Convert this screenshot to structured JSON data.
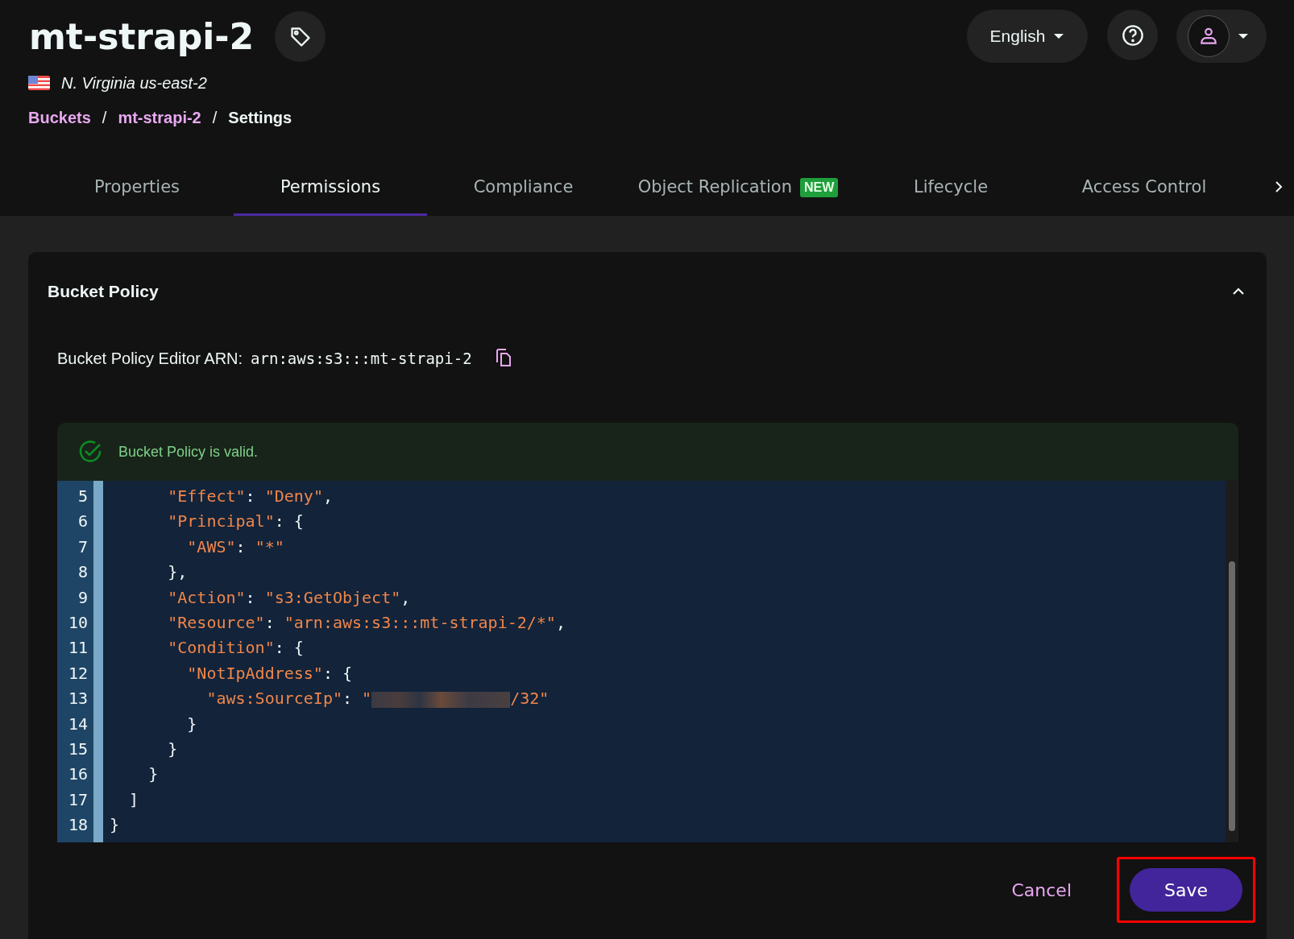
{
  "header": {
    "title": "mt-strapi-2",
    "region": "N. Virginia us-east-2",
    "breadcrumb_separator": "/",
    "breadcrumbs": [
      {
        "label": "Buckets",
        "link": true
      },
      {
        "label": "mt-strapi-2",
        "link": true
      },
      {
        "label": "Settings",
        "link": false
      }
    ],
    "language": "English"
  },
  "tabs": [
    {
      "label": "Properties",
      "selected": false
    },
    {
      "label": "Permissions",
      "selected": true
    },
    {
      "label": "Compliance",
      "selected": false
    },
    {
      "label": "Object Replication",
      "badge": "NEW",
      "selected": false
    },
    {
      "label": "Lifecycle",
      "selected": false
    },
    {
      "label": "Access Control",
      "selected": false
    }
  ],
  "panel": {
    "title": "Bucket Policy",
    "expanded": true,
    "arn_label": "Bucket Policy Editor ARN:",
    "arn": "arn:aws:s3:::mt-strapi-2",
    "validation": "Bucket Policy is valid.",
    "code_lines": [
      {
        "number": "5",
        "tokens": [
          {
            "kind": "key",
            "text": "      \"Effect\""
          },
          {
            "kind": "punct",
            "text": ": "
          },
          {
            "kind": "string",
            "text": "\"Deny\""
          },
          {
            "kind": "punct",
            "text": ","
          }
        ]
      },
      {
        "number": "6",
        "tokens": [
          {
            "kind": "key",
            "text": "      \"Principal\""
          },
          {
            "kind": "punct",
            "text": ": {"
          }
        ]
      },
      {
        "number": "7",
        "tokens": [
          {
            "kind": "key",
            "text": "        \"AWS\""
          },
          {
            "kind": "punct",
            "text": ": "
          },
          {
            "kind": "string",
            "text": "\"*\""
          }
        ]
      },
      {
        "number": "8",
        "tokens": [
          {
            "kind": "punct",
            "text": "      },"
          }
        ]
      },
      {
        "number": "9",
        "tokens": [
          {
            "kind": "key",
            "text": "      \"Action\""
          },
          {
            "kind": "punct",
            "text": ": "
          },
          {
            "kind": "string",
            "text": "\"s3:GetObject\""
          },
          {
            "kind": "punct",
            "text": ","
          }
        ]
      },
      {
        "number": "10",
        "tokens": [
          {
            "kind": "key",
            "text": "      \"Resource\""
          },
          {
            "kind": "punct",
            "text": ": "
          },
          {
            "kind": "string",
            "text": "\"arn:aws:s3:::mt-strapi-2/*\""
          },
          {
            "kind": "punct",
            "text": ","
          }
        ]
      },
      {
        "number": "11",
        "tokens": [
          {
            "kind": "key",
            "text": "      \"Condition\""
          },
          {
            "kind": "punct",
            "text": ": {"
          }
        ]
      },
      {
        "number": "12",
        "tokens": [
          {
            "kind": "key",
            "text": "        \"NotIpAddress\""
          },
          {
            "kind": "punct",
            "text": ": {"
          }
        ]
      },
      {
        "number": "13",
        "tokens": [
          {
            "kind": "key",
            "text": "          \"aws:SourceIp\""
          },
          {
            "kind": "punct",
            "text": ": "
          },
          {
            "kind": "string",
            "text": "\""
          },
          {
            "kind": "redacted"
          },
          {
            "kind": "string",
            "text": "/32\""
          }
        ]
      },
      {
        "number": "14",
        "tokens": [
          {
            "kind": "punct",
            "text": "        }"
          }
        ]
      },
      {
        "number": "15",
        "tokens": [
          {
            "kind": "punct",
            "text": "      }"
          }
        ]
      },
      {
        "number": "16",
        "tokens": [
          {
            "kind": "punct",
            "text": "    }"
          }
        ]
      },
      {
        "number": "17",
        "tokens": [
          {
            "kind": "punct",
            "text": "  ]"
          }
        ]
      },
      {
        "number": "18",
        "tokens": [
          {
            "kind": "punct",
            "text": "}"
          }
        ]
      }
    ],
    "buttons": [
      {
        "label": "Cancel",
        "kind": "text"
      },
      {
        "label": "Save",
        "kind": "primary",
        "highlighted": true
      }
    ]
  }
}
